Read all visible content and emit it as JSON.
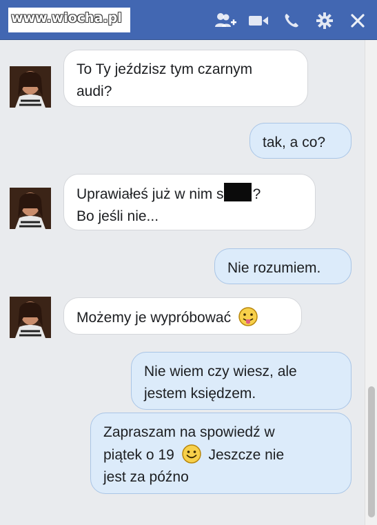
{
  "watermark": {
    "text": "www.wiocha.pl"
  },
  "toolbar": {
    "icons": [
      "add-friend-icon",
      "video-call-icon",
      "phone-icon",
      "gear-icon",
      "close-icon"
    ]
  },
  "messages": [
    {
      "from": "contact",
      "lines": [
        "To Ty jeździsz tym czarnym",
        "audi?"
      ]
    },
    {
      "from": "me",
      "lines": [
        "tak, a co?"
      ]
    },
    {
      "from": "contact",
      "line1_before": "Uprawiałeś już w nim s",
      "line1_after": "?",
      "line2": "Bo jeśli nie..."
    },
    {
      "from": "me",
      "lines": [
        "Nie rozumiem."
      ]
    },
    {
      "from": "contact",
      "text": "Możemy je wypróbować",
      "emoji": "tongue-out-emoji"
    },
    {
      "from": "me",
      "lines": [
        "Nie wiem czy wiesz, ale",
        "jestem księdzem."
      ]
    },
    {
      "from": "me",
      "line1": "Zapraszam na spowiedź w",
      "line2_before": "piątek o 19",
      "line2_after": "Jeszcze nie",
      "line3": "jest za późno",
      "emoji": "smile-emoji"
    }
  ],
  "colors": {
    "topbar": "#4267b2",
    "background": "#e9ebee",
    "bubble_in": "#ffffff",
    "bubble_out": "#dcebfa"
  }
}
